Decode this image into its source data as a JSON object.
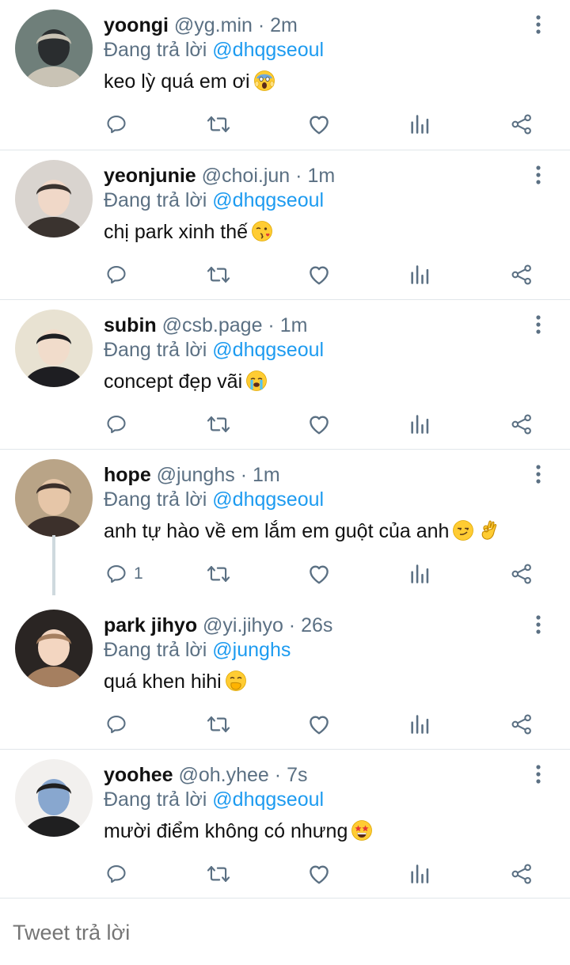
{
  "reply_prefix": "Đang trả lời",
  "colors": {
    "accent": "#1d9bf0",
    "muted": "#5b7083",
    "divider": "#e1e6ea"
  },
  "tweets": [
    {
      "name": "yoongi",
      "handle": "@yg.min",
      "dot": "·",
      "time": "2m",
      "reply_to": "@dhqgseoul",
      "text": "keo lỳ quá em ơi",
      "emoji": [
        "face-screaming-in-fear"
      ],
      "reply_count": ""
    },
    {
      "name": "yeonjunie",
      "handle": "@choi.jun",
      "dot": "·",
      "time": "1m",
      "reply_to": "@dhqgseoul",
      "text": "chị park xinh thế",
      "emoji": [
        "face-blowing-a-kiss"
      ],
      "reply_count": ""
    },
    {
      "name": "subin",
      "handle": "@csb.page",
      "dot": "·",
      "time": "1m",
      "reply_to": "@dhqgseoul",
      "text": "concept đẹp vãi",
      "emoji": [
        "loudly-crying-face"
      ],
      "reply_count": ""
    },
    {
      "name": "hope",
      "handle": "@junghs",
      "dot": "·",
      "time": "1m",
      "reply_to": "@dhqgseoul",
      "text": "anh tự hào về em lắm em guột của anh",
      "emoji": [
        "smirking-face",
        "ok-hand"
      ],
      "reply_count": "1"
    },
    {
      "name": "park jihyo",
      "handle": "@yi.jihyo",
      "dot": "·",
      "time": "26s",
      "reply_to": "@junghs",
      "text": "quá khen hihi",
      "emoji": [
        "face-with-hand-over-mouth"
      ],
      "reply_count": ""
    },
    {
      "name": "yoohee",
      "handle": "@oh.yhee",
      "dot": "·",
      "time": "7s",
      "reply_to": "@dhqgseoul",
      "text": "mười điểm không có nhưng",
      "emoji": [
        "star-struck"
      ],
      "reply_count": ""
    }
  ],
  "compose": {
    "placeholder": "Tweet trả lời"
  }
}
